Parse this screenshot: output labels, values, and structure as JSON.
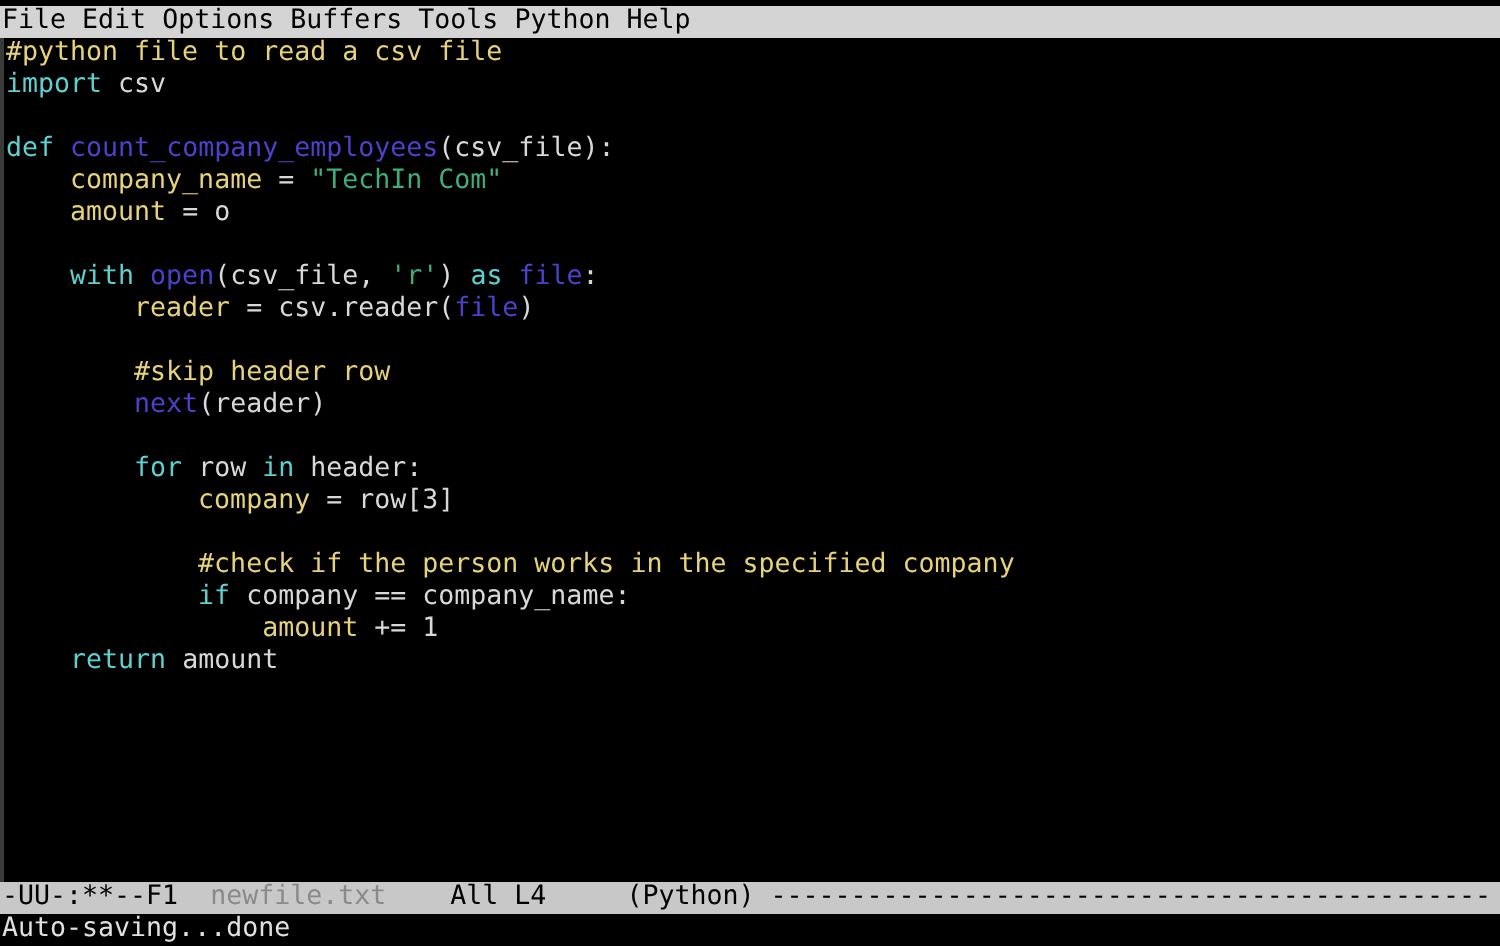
{
  "menu_bar": [
    "File",
    "Edit",
    "Options",
    "Buffers",
    "Tools",
    "Python",
    "Help"
  ],
  "code_lines": [
    {
      "kind": "code",
      "tokens": [
        {
          "kind": "comment",
          "text": "#python file to read a csv file"
        }
      ]
    },
    {
      "kind": "code",
      "tokens": [
        {
          "kind": "keyword",
          "text": "import "
        },
        {
          "kind": "plain",
          "text": "csv"
        }
      ]
    },
    {
      "kind": "blank"
    },
    {
      "kind": "code",
      "tokens": [
        {
          "kind": "keyword",
          "text": "def "
        },
        {
          "kind": "function",
          "text": "count_company_employees"
        },
        {
          "kind": "plain",
          "text": "(csv_file):"
        }
      ],
      "children": [
        {
          "kind": "code",
          "tokens": [
            {
              "kind": "variable",
              "text": "company_name"
            },
            {
              "kind": "plain",
              "text": " = "
            },
            {
              "kind": "string",
              "text": "\"TechIn Com\""
            }
          ]
        },
        {
          "kind": "code",
          "tokens": [
            {
              "kind": "variable",
              "text": "amount"
            },
            {
              "kind": "plain",
              "text": " = o"
            }
          ]
        },
        {
          "kind": "blank"
        },
        {
          "kind": "code",
          "tokens": [
            {
              "kind": "keyword",
              "text": "with "
            },
            {
              "kind": "function",
              "text": "open"
            },
            {
              "kind": "plain",
              "text": "(csv_file, "
            },
            {
              "kind": "string",
              "text": "'r'"
            },
            {
              "kind": "plain",
              "text": ") "
            },
            {
              "kind": "keyword",
              "text": "as "
            },
            {
              "kind": "function",
              "text": "file"
            },
            {
              "kind": "plain",
              "text": ":"
            }
          ],
          "children": [
            {
              "kind": "code",
              "tokens": [
                {
                  "kind": "variable",
                  "text": "reader"
                },
                {
                  "kind": "plain",
                  "text": " = csv.reader("
                },
                {
                  "kind": "function",
                  "text": "file"
                },
                {
                  "kind": "plain",
                  "text": ")"
                }
              ]
            },
            {
              "kind": "blank"
            },
            {
              "kind": "code",
              "tokens": [
                {
                  "kind": "comment",
                  "text": "#skip header row"
                }
              ]
            },
            {
              "kind": "code",
              "tokens": [
                {
                  "kind": "function",
                  "text": "next"
                },
                {
                  "kind": "plain",
                  "text": "(reader)"
                }
              ]
            },
            {
              "kind": "blank"
            },
            {
              "kind": "code",
              "tokens": [
                {
                  "kind": "keyword",
                  "text": "for "
                },
                {
                  "kind": "plain",
                  "text": "row "
                },
                {
                  "kind": "keyword",
                  "text": "in "
                },
                {
                  "kind": "plain",
                  "text": "header:"
                }
              ],
              "children": [
                {
                  "kind": "code",
                  "tokens": [
                    {
                      "kind": "variable",
                      "text": "company"
                    },
                    {
                      "kind": "plain",
                      "text": " = row[3]"
                    }
                  ]
                },
                {
                  "kind": "blank"
                },
                {
                  "kind": "code",
                  "tokens": [
                    {
                      "kind": "comment",
                      "text": "#check if the person works in the specified company"
                    }
                  ]
                },
                {
                  "kind": "code",
                  "tokens": [
                    {
                      "kind": "keyword",
                      "text": "if "
                    },
                    {
                      "kind": "plain",
                      "text": "company == company_name:"
                    }
                  ],
                  "children": [
                    {
                      "kind": "code",
                      "tokens": [
                        {
                          "kind": "variable",
                          "text": "amount"
                        },
                        {
                          "kind": "plain",
                          "text": " += 1"
                        }
                      ]
                    }
                  ]
                }
              ]
            }
          ]
        },
        {
          "kind": "code",
          "tokens": [
            {
              "kind": "keyword",
              "text": "return "
            },
            {
              "kind": "plain",
              "text": "amount"
            }
          ]
        }
      ]
    }
  ],
  "mode_line": {
    "status": "-UU-:**--F1",
    "buffer_name": "newfile.txt",
    "position": "All L4",
    "mode": "(Python)",
    "fill": "---------------------------------------------"
  },
  "echo_area": "Auto-saving...done"
}
